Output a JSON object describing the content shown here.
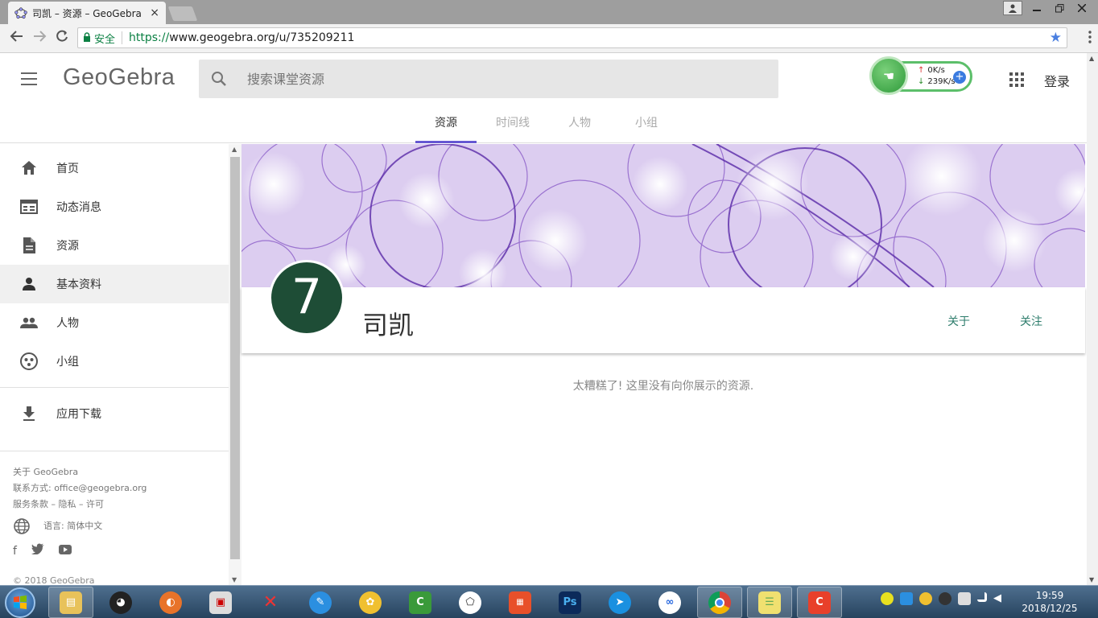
{
  "browser": {
    "tab_title": "司凯 – 资源 – GeoGebra",
    "tab_close": "×",
    "secure_label": "安全",
    "url_scheme": "https://",
    "url_rest": "www.geogebra.org/u/735209211"
  },
  "header": {
    "logo": "GeoGebra",
    "search_placeholder": "搜索课堂资源",
    "login": "登录",
    "speed_up": "0K/s",
    "speed_down": "239K/s"
  },
  "profile_tabs": [
    {
      "label": "资源",
      "active": true
    },
    {
      "label": "时间线",
      "active": false
    },
    {
      "label": "人物",
      "active": false
    },
    {
      "label": "小组",
      "active": false
    }
  ],
  "sidebar": {
    "items": [
      {
        "label": "首页",
        "icon": "home-icon"
      },
      {
        "label": "动态消息",
        "icon": "news-feed-icon"
      },
      {
        "label": "资源",
        "icon": "document-icon"
      },
      {
        "label": "基本资料",
        "icon": "person-icon",
        "active": true
      },
      {
        "label": "人物",
        "icon": "people-icon"
      },
      {
        "label": "小组",
        "icon": "groups-icon"
      }
    ],
    "download": "应用下载",
    "footer": {
      "about": "关于 GeoGebra",
      "contact": "联系方式: office@geogebra.org",
      "terms": "服务条款 – 隐私 – 许可",
      "language": "语言: 简体中文",
      "copyright": "© 2018 GeoGebra"
    }
  },
  "profile": {
    "avatar_text": "7",
    "avatar_color": "#1e4d36",
    "name": "司凯",
    "about": "关于",
    "follow": "关注",
    "empty_message": "太糟糕了! 这里没有向你展示的资源."
  },
  "taskbar": {
    "time": "19:59",
    "date": "2018/12/25"
  },
  "colors": {
    "accent": "#6557d2",
    "link": "#2e7d6c"
  }
}
